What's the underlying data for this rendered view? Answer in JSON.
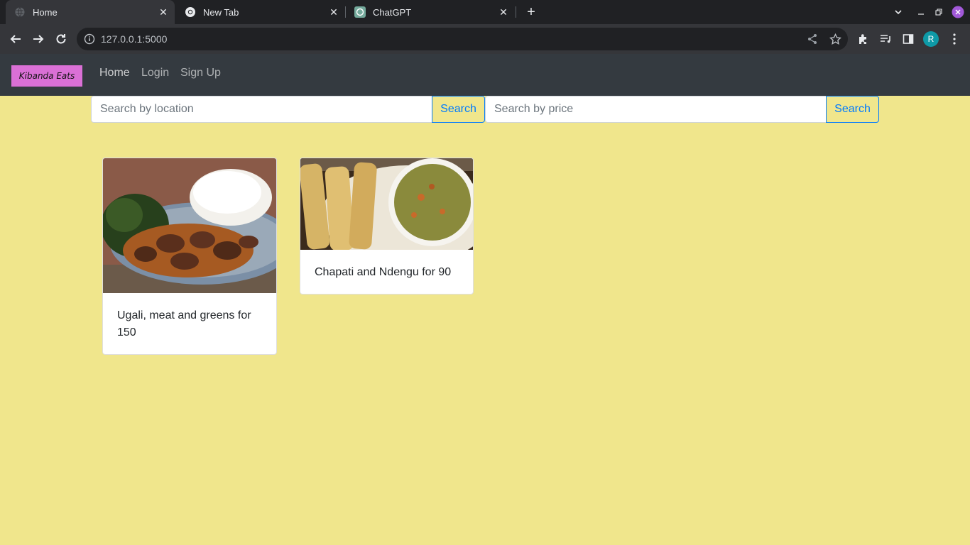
{
  "browser": {
    "tabs": [
      {
        "title": "Home",
        "icon": "globe-icon"
      },
      {
        "title": "New Tab",
        "icon": "chrome-icon"
      },
      {
        "title": "ChatGPT",
        "icon": "chatgpt-icon"
      }
    ],
    "url": "127.0.0.1:5000",
    "profile_initial": "R"
  },
  "navbar": {
    "brand": "Kibanda Eats",
    "links": [
      "Home",
      "Login",
      "Sign Up"
    ]
  },
  "search": {
    "location_placeholder": "Search by location",
    "price_placeholder": "Search by price",
    "button_label": "Search"
  },
  "cards": [
    {
      "caption": "Ugali, meat and greens for 150",
      "image": "ugali-meat-greens-photo"
    },
    {
      "caption": "Chapati and Ndengu for 90",
      "image": "chapati-ndengu-photo"
    }
  ],
  "colors": {
    "page_bg": "#f0e68c",
    "navbar_bg": "#343a40",
    "brand_bg": "#da70d6",
    "primary": "#007bff"
  }
}
